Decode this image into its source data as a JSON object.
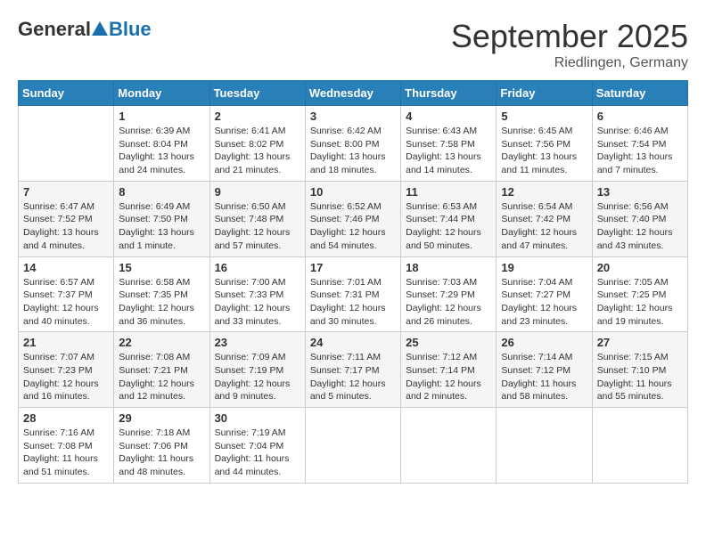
{
  "header": {
    "logo_general": "General",
    "logo_blue": "Blue",
    "month_title": "September 2025",
    "location": "Riedlingen, Germany"
  },
  "calendar": {
    "days_of_week": [
      "Sunday",
      "Monday",
      "Tuesday",
      "Wednesday",
      "Thursday",
      "Friday",
      "Saturday"
    ],
    "weeks": [
      [
        {
          "day": "",
          "info": ""
        },
        {
          "day": "1",
          "info": "Sunrise: 6:39 AM\nSunset: 8:04 PM\nDaylight: 13 hours\nand 24 minutes."
        },
        {
          "day": "2",
          "info": "Sunrise: 6:41 AM\nSunset: 8:02 PM\nDaylight: 13 hours\nand 21 minutes."
        },
        {
          "day": "3",
          "info": "Sunrise: 6:42 AM\nSunset: 8:00 PM\nDaylight: 13 hours\nand 18 minutes."
        },
        {
          "day": "4",
          "info": "Sunrise: 6:43 AM\nSunset: 7:58 PM\nDaylight: 13 hours\nand 14 minutes."
        },
        {
          "day": "5",
          "info": "Sunrise: 6:45 AM\nSunset: 7:56 PM\nDaylight: 13 hours\nand 11 minutes."
        },
        {
          "day": "6",
          "info": "Sunrise: 6:46 AM\nSunset: 7:54 PM\nDaylight: 13 hours\nand 7 minutes."
        }
      ],
      [
        {
          "day": "7",
          "info": "Sunrise: 6:47 AM\nSunset: 7:52 PM\nDaylight: 13 hours\nand 4 minutes."
        },
        {
          "day": "8",
          "info": "Sunrise: 6:49 AM\nSunset: 7:50 PM\nDaylight: 13 hours\nand 1 minute."
        },
        {
          "day": "9",
          "info": "Sunrise: 6:50 AM\nSunset: 7:48 PM\nDaylight: 12 hours\nand 57 minutes."
        },
        {
          "day": "10",
          "info": "Sunrise: 6:52 AM\nSunset: 7:46 PM\nDaylight: 12 hours\nand 54 minutes."
        },
        {
          "day": "11",
          "info": "Sunrise: 6:53 AM\nSunset: 7:44 PM\nDaylight: 12 hours\nand 50 minutes."
        },
        {
          "day": "12",
          "info": "Sunrise: 6:54 AM\nSunset: 7:42 PM\nDaylight: 12 hours\nand 47 minutes."
        },
        {
          "day": "13",
          "info": "Sunrise: 6:56 AM\nSunset: 7:40 PM\nDaylight: 12 hours\nand 43 minutes."
        }
      ],
      [
        {
          "day": "14",
          "info": "Sunrise: 6:57 AM\nSunset: 7:37 PM\nDaylight: 12 hours\nand 40 minutes."
        },
        {
          "day": "15",
          "info": "Sunrise: 6:58 AM\nSunset: 7:35 PM\nDaylight: 12 hours\nand 36 minutes."
        },
        {
          "day": "16",
          "info": "Sunrise: 7:00 AM\nSunset: 7:33 PM\nDaylight: 12 hours\nand 33 minutes."
        },
        {
          "day": "17",
          "info": "Sunrise: 7:01 AM\nSunset: 7:31 PM\nDaylight: 12 hours\nand 30 minutes."
        },
        {
          "day": "18",
          "info": "Sunrise: 7:03 AM\nSunset: 7:29 PM\nDaylight: 12 hours\nand 26 minutes."
        },
        {
          "day": "19",
          "info": "Sunrise: 7:04 AM\nSunset: 7:27 PM\nDaylight: 12 hours\nand 23 minutes."
        },
        {
          "day": "20",
          "info": "Sunrise: 7:05 AM\nSunset: 7:25 PM\nDaylight: 12 hours\nand 19 minutes."
        }
      ],
      [
        {
          "day": "21",
          "info": "Sunrise: 7:07 AM\nSunset: 7:23 PM\nDaylight: 12 hours\nand 16 minutes."
        },
        {
          "day": "22",
          "info": "Sunrise: 7:08 AM\nSunset: 7:21 PM\nDaylight: 12 hours\nand 12 minutes."
        },
        {
          "day": "23",
          "info": "Sunrise: 7:09 AM\nSunset: 7:19 PM\nDaylight: 12 hours\nand 9 minutes."
        },
        {
          "day": "24",
          "info": "Sunrise: 7:11 AM\nSunset: 7:17 PM\nDaylight: 12 hours\nand 5 minutes."
        },
        {
          "day": "25",
          "info": "Sunrise: 7:12 AM\nSunset: 7:14 PM\nDaylight: 12 hours\nand 2 minutes."
        },
        {
          "day": "26",
          "info": "Sunrise: 7:14 AM\nSunset: 7:12 PM\nDaylight: 11 hours\nand 58 minutes."
        },
        {
          "day": "27",
          "info": "Sunrise: 7:15 AM\nSunset: 7:10 PM\nDaylight: 11 hours\nand 55 minutes."
        }
      ],
      [
        {
          "day": "28",
          "info": "Sunrise: 7:16 AM\nSunset: 7:08 PM\nDaylight: 11 hours\nand 51 minutes."
        },
        {
          "day": "29",
          "info": "Sunrise: 7:18 AM\nSunset: 7:06 PM\nDaylight: 11 hours\nand 48 minutes."
        },
        {
          "day": "30",
          "info": "Sunrise: 7:19 AM\nSunset: 7:04 PM\nDaylight: 11 hours\nand 44 minutes."
        },
        {
          "day": "",
          "info": ""
        },
        {
          "day": "",
          "info": ""
        },
        {
          "day": "",
          "info": ""
        },
        {
          "day": "",
          "info": ""
        }
      ]
    ]
  }
}
